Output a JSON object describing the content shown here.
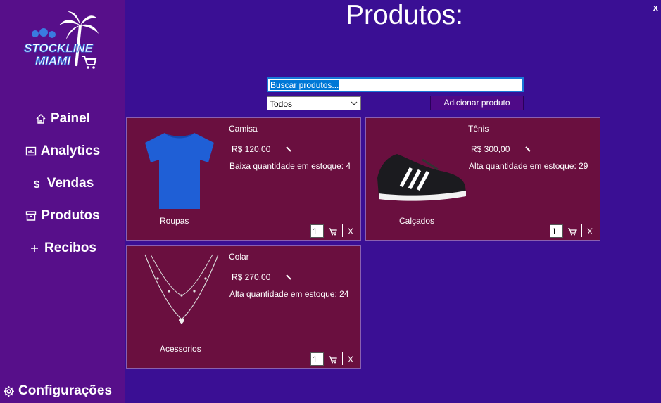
{
  "window": {
    "close_label": "x"
  },
  "brand": {
    "logo_line1": "STOCKLINE",
    "logo_line2": "MIAMI"
  },
  "sidebar": {
    "items": [
      {
        "label": "Painel",
        "icon": "home-icon"
      },
      {
        "label": "Analytics",
        "icon": "chart-icon"
      },
      {
        "label": "Vendas",
        "icon": "dollar-icon"
      },
      {
        "label": "Produtos",
        "icon": "box-icon"
      },
      {
        "label": "Recibos",
        "icon": "plus-icon"
      }
    ],
    "settings_label": "Configurações"
  },
  "page": {
    "title": "Produtos:"
  },
  "search": {
    "value": "Buscar produtos..."
  },
  "filter": {
    "selected": "Todos"
  },
  "toolbar": {
    "add_label": "Adicionar produto"
  },
  "colors": {
    "background": "#3a0f94",
    "sidebar": "#570f8a",
    "card": "#6a0f3f",
    "button": "#4f0a88"
  },
  "products": [
    {
      "name": "Camisa",
      "price": "R$ 120,00",
      "stock": "Baixa quantidade em estoque: 4",
      "category": "Roupas",
      "qty": "1",
      "image": "blue-tshirt",
      "delete_label": "X"
    },
    {
      "name": "Tênis",
      "price": "R$ 300,00",
      "stock": "Alta quantidade em estoque: 29",
      "category": "Calçados",
      "qty": "1",
      "image": "black-sneaker",
      "delete_label": "X"
    },
    {
      "name": "Colar",
      "price": "R$ 270,00",
      "stock": "Alta quantidade em estoque: 24",
      "category": "Acessorios",
      "qty": "1",
      "image": "silver-necklace",
      "delete_label": "X"
    }
  ]
}
